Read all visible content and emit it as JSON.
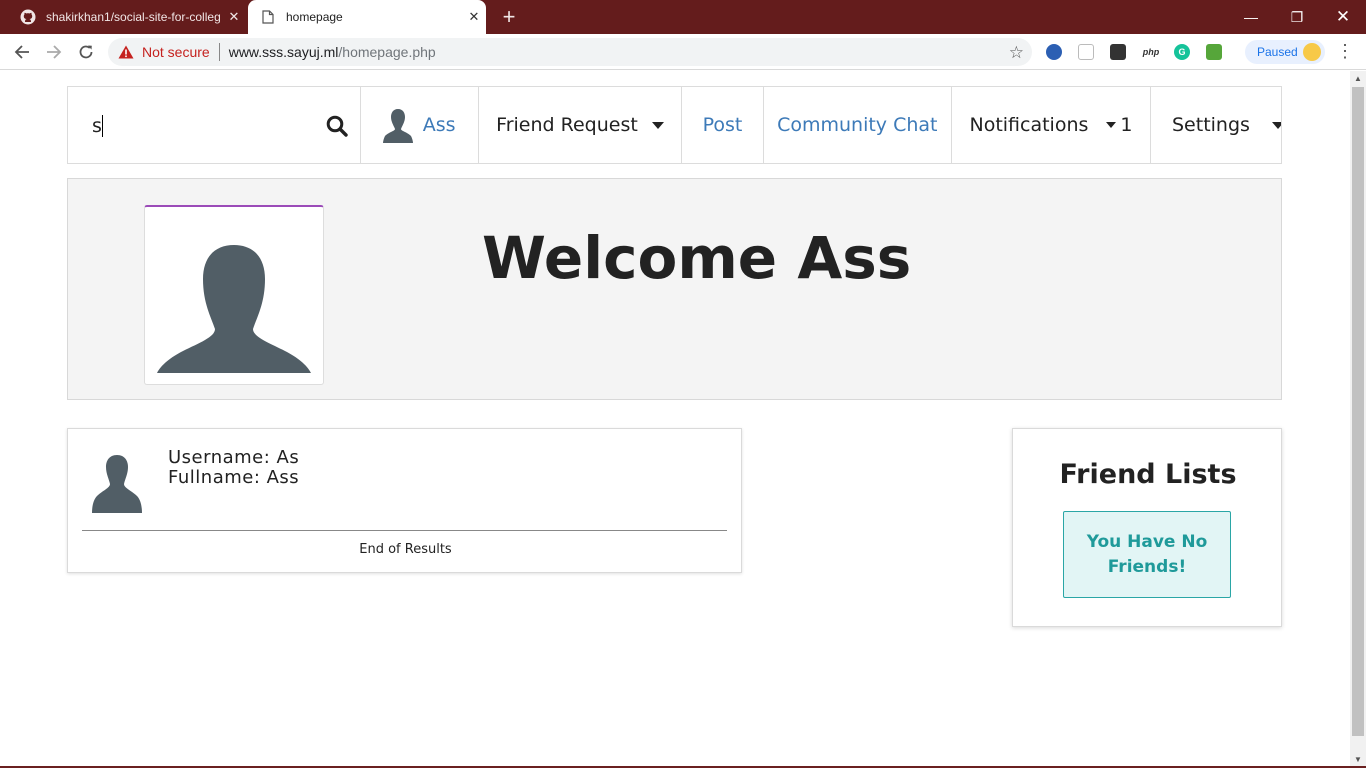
{
  "browser": {
    "tabs": [
      {
        "title": "shakirkhan1/social-site-for-colleg",
        "active": false,
        "icon": "github-icon"
      },
      {
        "title": "homepage",
        "active": true,
        "icon": "page-icon"
      }
    ],
    "new_tab": "+",
    "address": {
      "security_label": "Not secure",
      "host": "www.sss.sayuj.ml",
      "path": "/homepage.php"
    },
    "profile_label": "Paused",
    "extensions": [
      {
        "name": "ext-globe-icon",
        "color": "#2c5fb3",
        "text": ""
      },
      {
        "name": "ext-doc-icon",
        "color": "#bdbdbd",
        "text": ""
      },
      {
        "name": "ext-trello-icon",
        "color": "#333333",
        "text": ""
      },
      {
        "name": "ext-php-icon",
        "color": "#ffffff",
        "text": "php"
      },
      {
        "name": "ext-grammarly-icon",
        "color": "#15c39a",
        "text": "G"
      },
      {
        "name": "ext-download-icon",
        "color": "#56a63a",
        "text": ""
      }
    ],
    "colors": {
      "frame": "#641c1c",
      "not_secure": "#c5221f"
    }
  },
  "nav": {
    "search_value": "s",
    "user_name": "Ass",
    "friend_request": "Friend Request",
    "post": "Post",
    "community_chat": "Community Chat",
    "notifications": "Notifications",
    "notifications_count": "1",
    "settings": "Settings"
  },
  "welcome": {
    "title": "Welcome Ass"
  },
  "search_result": {
    "username_line": "Username: As",
    "fullname_line": "Fullname: Ass",
    "end_text": "End of Results"
  },
  "friends": {
    "title": "Friend Lists",
    "empty_message": "You Have No Friends!"
  },
  "colors": {
    "link": "#3d7ab8",
    "avatar": "#515e66",
    "alert_border": "#2aa6a6",
    "alert_bg": "#e2f5f5",
    "avatar_frame_accent": "#9b4bb8"
  }
}
